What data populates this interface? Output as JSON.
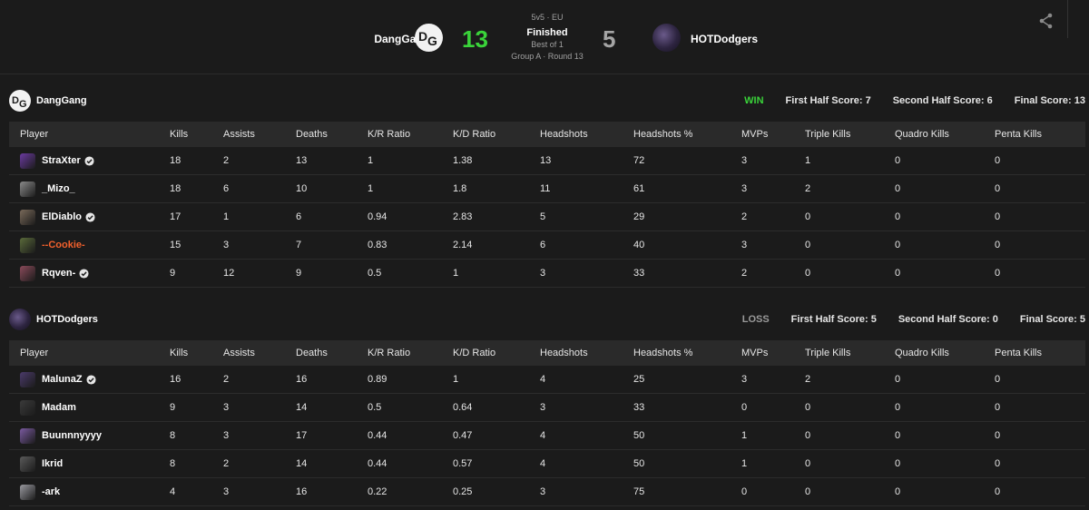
{
  "match": {
    "format": "5v5 · EU",
    "status": "Finished",
    "best_of": "Best of 1",
    "round_info": "Group A · Round 13",
    "team_a": {
      "name": "DangGang",
      "score": "13"
    },
    "team_b": {
      "name": "HOTDodgers",
      "score": "5"
    }
  },
  "columns": [
    "Player",
    "Kills",
    "Assists",
    "Deaths",
    "K/R Ratio",
    "K/D Ratio",
    "Headshots",
    "Headshots %",
    "MVPs",
    "Triple Kills",
    "Quadro Kills",
    "Penta Kills"
  ],
  "teams": [
    {
      "name": "DangGang",
      "result": "WIN",
      "first_half": "First Half Score: 7",
      "second_half": "Second Half Score: 6",
      "final": "Final Score: 13",
      "players": [
        {
          "name": "StraXter",
          "verified": true,
          "color": "#ffffff",
          "avatar": "#6b3aa0",
          "stats": [
            "18",
            "2",
            "13",
            "1",
            "1.38",
            "13",
            "72",
            "3",
            "1",
            "0",
            "0"
          ]
        },
        {
          "name": "_Mizo_",
          "verified": false,
          "color": "#ffffff",
          "avatar": "#8a8a8a",
          "stats": [
            "18",
            "6",
            "10",
            "1",
            "1.8",
            "11",
            "61",
            "3",
            "2",
            "0",
            "0"
          ]
        },
        {
          "name": "ElDiablo",
          "verified": true,
          "color": "#ffffff",
          "avatar": "#7a6a5a",
          "stats": [
            "17",
            "1",
            "6",
            "0.94",
            "2.83",
            "5",
            "29",
            "2",
            "0",
            "0",
            "0"
          ]
        },
        {
          "name": "--Cookie-",
          "verified": false,
          "color": "#f2602c",
          "avatar": "#5a6a3a",
          "stats": [
            "15",
            "3",
            "7",
            "0.83",
            "2.14",
            "6",
            "40",
            "3",
            "0",
            "0",
            "0"
          ]
        },
        {
          "name": "Rqven-",
          "verified": true,
          "color": "#ffffff",
          "avatar": "#8a4a5a",
          "stats": [
            "9",
            "12",
            "9",
            "0.5",
            "1",
            "3",
            "33",
            "2",
            "0",
            "0",
            "0"
          ]
        }
      ]
    },
    {
      "name": "HOTDodgers",
      "result": "LOSS",
      "first_half": "First Half Score: 5",
      "second_half": "Second Half Score: 0",
      "final": "Final Score: 5",
      "players": [
        {
          "name": "MalunaZ",
          "verified": true,
          "color": "#ffffff",
          "avatar": "#4a3a6a",
          "stats": [
            "16",
            "2",
            "16",
            "0.89",
            "1",
            "4",
            "25",
            "3",
            "2",
            "0",
            "0"
          ]
        },
        {
          "name": "Madam",
          "verified": false,
          "color": "#ffffff",
          "avatar": "#3a3a3a",
          "stats": [
            "9",
            "3",
            "14",
            "0.5",
            "0.64",
            "3",
            "33",
            "0",
            "0",
            "0",
            "0"
          ]
        },
        {
          "name": "Buunnnyyyy",
          "verified": false,
          "color": "#ffffff",
          "avatar": "#7a5aa0",
          "stats": [
            "8",
            "3",
            "17",
            "0.44",
            "0.47",
            "4",
            "50",
            "1",
            "0",
            "0",
            "0"
          ]
        },
        {
          "name": "Ikrid",
          "verified": false,
          "color": "#ffffff",
          "avatar": "#5a5a5a",
          "stats": [
            "8",
            "2",
            "14",
            "0.44",
            "0.57",
            "4",
            "50",
            "1",
            "0",
            "0",
            "0"
          ]
        },
        {
          "name": "-ark",
          "verified": false,
          "color": "#ffffff",
          "avatar": "#9a9aa0",
          "stats": [
            "4",
            "3",
            "16",
            "0.22",
            "0.25",
            "3",
            "75",
            "0",
            "0",
            "0",
            "0"
          ]
        }
      ]
    }
  ],
  "colors": {
    "win": "#3ad33a",
    "loss": "#9a9a9a",
    "bg": "#1b1b1b",
    "header_row": "#2a2a2a"
  },
  "icons": {
    "share": "share-icon",
    "verified": "verified-icon"
  }
}
